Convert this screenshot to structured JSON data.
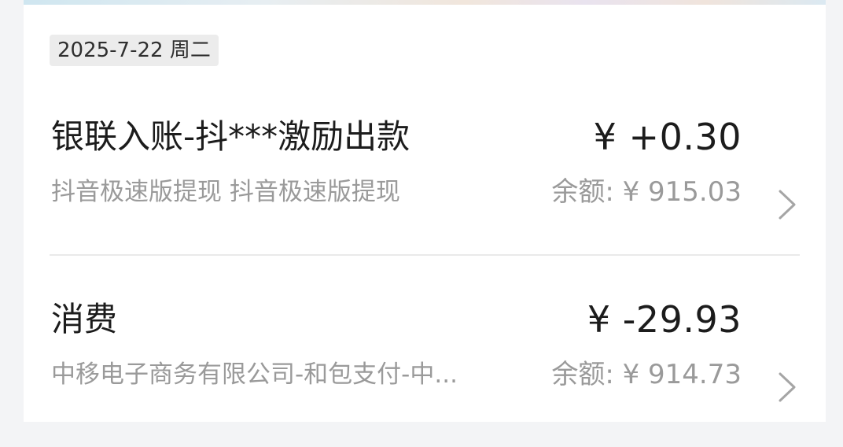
{
  "date_header": "2025-7-22 周二",
  "transactions": [
    {
      "title": "银联入账-抖***激励出款",
      "amount": "¥ +0.30",
      "description": "抖音极速版提现 抖音极速版提现",
      "balance": "余额: ¥ 915.03"
    },
    {
      "title": "消费",
      "amount": "¥ -29.93",
      "description": "中移电子商务有限公司-和包支付-中...",
      "balance": "余额: ¥ 914.73"
    }
  ],
  "icons": {
    "row_arrow": "chevron-right-icon"
  },
  "colors": {
    "primary_text": "#1c1c1c",
    "secondary_text": "#9a9a9a",
    "chip_background": "#ececec",
    "divider": "#eaeaea"
  }
}
